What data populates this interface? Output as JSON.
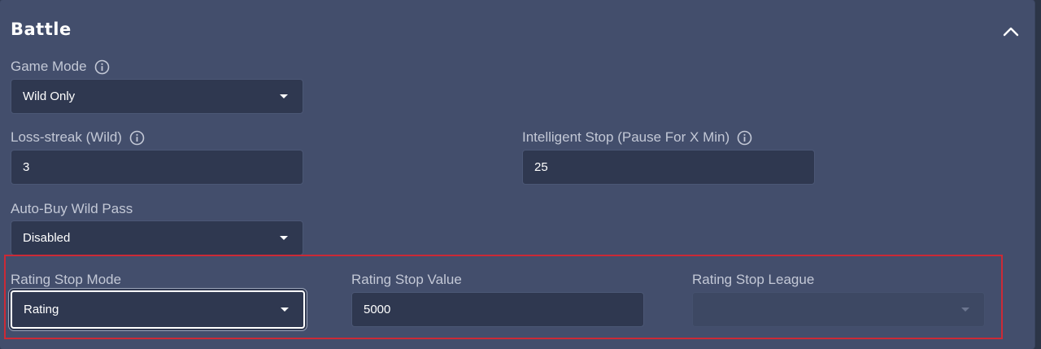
{
  "section": {
    "title": "Battle",
    "collapse_icon": "chevron-up-icon"
  },
  "game_mode": {
    "label": "Game Mode",
    "value": "Wild Only",
    "has_info": true
  },
  "loss_streak": {
    "label": "Loss-streak (Wild)",
    "value": "3",
    "has_info": true
  },
  "intelligent_stop": {
    "label": "Intelligent Stop (Pause For X Min)",
    "value": "25",
    "has_info": true
  },
  "auto_buy": {
    "label": "Auto-Buy Wild Pass",
    "value": "Disabled"
  },
  "rating_stop_mode": {
    "label": "Rating Stop Mode",
    "value": "Rating"
  },
  "rating_stop_value": {
    "label": "Rating Stop Value",
    "value": "5000"
  },
  "rating_stop_league": {
    "label": "Rating Stop League",
    "value": ""
  },
  "colors": {
    "panel": "#434e6c",
    "field": "#2f3850",
    "highlight": "#cc2a36"
  }
}
